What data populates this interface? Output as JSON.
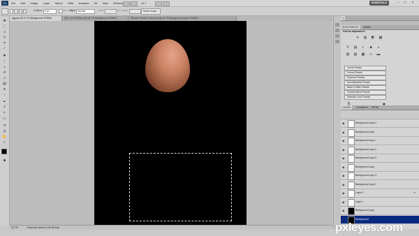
{
  "app": {
    "logo": "Ps"
  },
  "menu": [
    "File",
    "Edit",
    "Image",
    "Layer",
    "Select",
    "Filter",
    "Analysis",
    "3D",
    "View",
    "Window",
    "Help"
  ],
  "menubar_extra": {
    "zoom": "41.7",
    "workspace": "ESSENTIALS"
  },
  "options": {
    "feather_label": "Feather:",
    "feather_value": "0 px",
    "antialias_label": "Anti-alias",
    "style_label": "Style:",
    "style_value": "Normal",
    "width_label": "Width:",
    "height_label": "Height:",
    "refine_edge": "Refine Edge..."
  },
  "doc_tabs": [
    "egg.psd @ 41.7% (Background, RGB/8)",
    "DSC_5174.NEF.psd @ 16.7% (Background, RGB/8*)",
    "Effective Stars for Jeans.psd @ 16.7% (Background copy 8, RGB/8*)"
  ],
  "status": {
    "zoom": "41.7%",
    "info": "Exposure works in 32-bit only"
  },
  "panels": {
    "top_tabs": [
      "ADJUSTMENTS",
      "MASKS"
    ],
    "adj_title": "Add an adjustment",
    "adj_icons_row1": [
      "☀",
      "▥",
      "◩",
      "▦"
    ],
    "adj_icons_row2": [
      "V",
      "▤",
      "◐",
      "■",
      "◒"
    ],
    "adj_icons_row3": [
      "▨",
      "▧",
      "▩",
      "▭",
      "▬"
    ],
    "presets": [
      "Levels Presets",
      "Curves Presets",
      "Exposure Presets",
      "Hue/Saturation Presets",
      "Black & White Presets",
      "Channel Mixer Presets",
      "Selective Color Presets"
    ],
    "layer_tabs": [
      "LAYERS",
      "CHANNELS",
      "PATHS"
    ]
  },
  "layers": [
    {
      "name": "Background copy 4",
      "fx": "",
      "dark": false,
      "selected": false
    },
    {
      "name": "Background copy",
      "fx": "",
      "dark": false,
      "selected": false
    },
    {
      "name": "Background copy 7",
      "fx": "",
      "dark": false,
      "selected": false
    },
    {
      "name": "Background copy 6",
      "fx": "",
      "dark": false,
      "selected": false
    },
    {
      "name": "Background copy 5",
      "fx": "",
      "dark": false,
      "selected": false
    },
    {
      "name": "Background copy",
      "fx": "",
      "dark": false,
      "selected": false
    },
    {
      "name": "Background copy 3",
      "fx": "",
      "dark": false,
      "selected": false
    },
    {
      "name": "Background copy 2",
      "fx": "",
      "dark": false,
      "selected": false
    },
    {
      "name": "Layer 2",
      "fx": "fx",
      "dark": false,
      "selected": false
    },
    {
      "name": "Layer 1",
      "fx": "",
      "dark": false,
      "selected": false
    },
    {
      "name": "Background copy",
      "fx": "",
      "dark": true,
      "selected": false
    },
    {
      "name": "Background",
      "fx": "",
      "dark": true,
      "selected": true
    }
  ],
  "watermark": "pxleyes.com",
  "colors": {
    "canvas": "#000000",
    "selected_layer": "#0a2a82",
    "workspace_button": "#5b5b5b"
  }
}
